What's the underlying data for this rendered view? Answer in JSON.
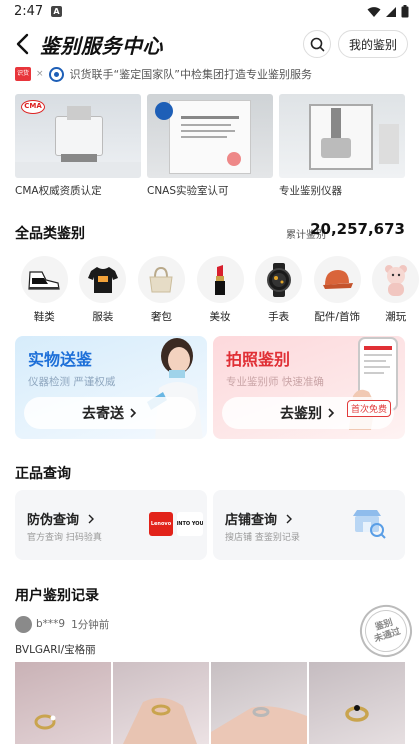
{
  "status_bar": {
    "time": "2:47",
    "notification_badge": "A"
  },
  "header": {
    "title": "鉴别服务中心",
    "my_button": "我的鉴别"
  },
  "partner": {
    "logo_text": "识货",
    "text": "识货联手“鉴定国家队”中检集团打造专业鉴别服务"
  },
  "certifications": [
    {
      "caption": "CMA权威资质认定",
      "badge": "CMA"
    },
    {
      "caption": "CNAS实验室认可"
    },
    {
      "caption": "专业鉴别仪器"
    }
  ],
  "all_categories": {
    "title": "全品类鉴别",
    "total_label": "累计鉴别",
    "total_value": "20,257,673",
    "items": [
      {
        "label": "鞋类",
        "icon": "sneaker-icon"
      },
      {
        "label": "服装",
        "icon": "tshirt-icon"
      },
      {
        "label": "奢包",
        "icon": "handbag-icon"
      },
      {
        "label": "美妆",
        "icon": "lipstick-icon"
      },
      {
        "label": "手表",
        "icon": "watch-icon"
      },
      {
        "label": "配件/首饰",
        "icon": "cap-icon"
      },
      {
        "label": "潮玩",
        "icon": "toy-bear-icon"
      }
    ]
  },
  "services": {
    "physical": {
      "title": "实物送鉴",
      "subtitle": "仪器检测 严谨权威",
      "button": "去寄送"
    },
    "photo": {
      "title": "拍照鉴别",
      "subtitle": "专业鉴别师 快速准确",
      "button": "去鉴别",
      "tag": "首次免费"
    }
  },
  "authenticity": {
    "title": "正品查询",
    "anti_fake": {
      "title": "防伪查询",
      "subtitle": "官方查询 扫码验真",
      "logos": [
        "Lenovo",
        "INTO YOU"
      ]
    },
    "store": {
      "title": "店铺查询",
      "subtitle": "搜店铺 查鉴别记录"
    }
  },
  "records": {
    "title": "用户鉴别记录",
    "user": "b***9",
    "time": "1分钟前",
    "brand": "BVLGARI/宝格丽",
    "stamp_line1": "鉴别",
    "stamp_line2": "未通过"
  },
  "colors": {
    "accent_red": "#e13b3b",
    "blue_title": "#1d6fd8",
    "pink_title": "#e02f35"
  }
}
